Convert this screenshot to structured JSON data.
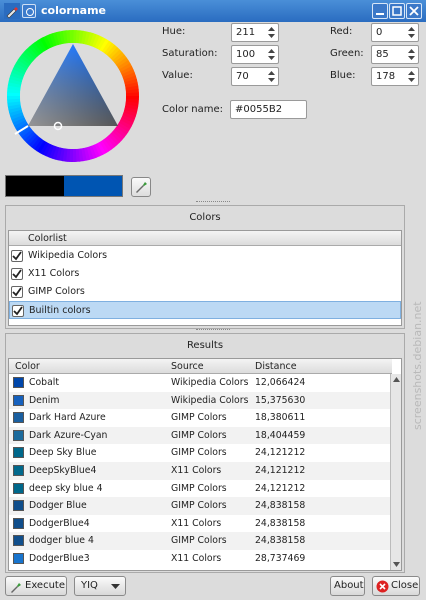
{
  "window": {
    "title": "colorname"
  },
  "picker": {
    "hue_label": "Hue:",
    "hue": "211",
    "saturation_label": "Saturation:",
    "saturation": "100",
    "value_label": "Value:",
    "value": "70",
    "red_label": "Red:",
    "red": "0",
    "green_label": "Green:",
    "green": "85",
    "blue_label": "Blue:",
    "blue": "178",
    "color_name_label": "Color name:",
    "color_name": "#0055B2",
    "old_color": "#000000",
    "new_color": "#0055B2"
  },
  "colors_panel": {
    "title": "Colors",
    "header": "Colorlist",
    "items": [
      {
        "label": "Wikipedia Colors",
        "checked": true
      },
      {
        "label": "X11 Colors",
        "checked": true
      },
      {
        "label": "GIMP Colors",
        "checked": true
      },
      {
        "label": "Builtin colors",
        "checked": true,
        "selected": true
      }
    ]
  },
  "results_panel": {
    "title": "Results",
    "headers": {
      "color": "Color",
      "source": "Source",
      "distance": "Distance"
    },
    "rows": [
      {
        "name": "Cobalt",
        "source": "Wikipedia Colors",
        "distance": "12,066424",
        "swatch": "#0047AB"
      },
      {
        "name": "Denim",
        "source": "Wikipedia Colors",
        "distance": "15,375630",
        "swatch": "#1560BD"
      },
      {
        "name": "Dark Hard Azure",
        "source": "GIMP Colors",
        "distance": "18,380611",
        "swatch": "#1A5FA0"
      },
      {
        "name": "Dark Azure-Cyan",
        "source": "GIMP Colors",
        "distance": "18,404459",
        "swatch": "#1B6A9C"
      },
      {
        "name": "Deep Sky Blue",
        "source": "GIMP Colors",
        "distance": "24,121212",
        "swatch": "#00688B"
      },
      {
        "name": "DeepSkyBlue4",
        "source": "X11 Colors",
        "distance": "24,121212",
        "swatch": "#00688B"
      },
      {
        "name": "deep sky blue 4",
        "source": "GIMP Colors",
        "distance": "24,121212",
        "swatch": "#00688B"
      },
      {
        "name": "Dodger Blue",
        "source": "GIMP Colors",
        "distance": "24,838158",
        "swatch": "#104E8B"
      },
      {
        "name": "DodgerBlue4",
        "source": "X11 Colors",
        "distance": "24,838158",
        "swatch": "#104E8B"
      },
      {
        "name": "dodger blue 4",
        "source": "GIMP Colors",
        "distance": "24,838158",
        "swatch": "#104E8B"
      },
      {
        "name": "DodgerBlue3",
        "source": "X11 Colors",
        "distance": "28,737469",
        "swatch": "#1874CD"
      }
    ]
  },
  "bottom_bar": {
    "execute_label": "Execute",
    "space_select": "YIQ",
    "about_label": "About",
    "close_label": "Close"
  },
  "watermark": "screenshots.debian.net"
}
